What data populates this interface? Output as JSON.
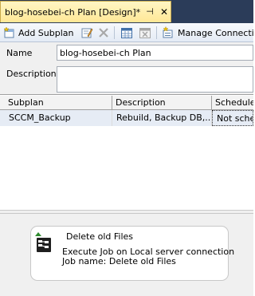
{
  "tab": {
    "title": "blog-hosebei-ch Plan [Design]*",
    "pin_glyph": "⊣",
    "close_glyph": "✕"
  },
  "toolbar": {
    "add_subplan_label": "Add Subplan",
    "manage_connections_label": "Manage Connecti"
  },
  "form": {
    "name_label": "Name",
    "name_value": "blog-hosebei-ch Plan",
    "description_label": "Description",
    "description_value": ""
  },
  "grid": {
    "headers": {
      "subplan": "Subplan",
      "description": "Description",
      "schedule": "Schedule"
    },
    "rows": [
      {
        "subplan": "SCCM_Backup",
        "description": "Rebuild, Backup DB,...",
        "schedule": "Not sched"
      }
    ]
  },
  "task": {
    "title": "Delete old Files",
    "line1": "Execute Job on Local server connection",
    "line2": "Job name: Delete old Files"
  },
  "colors": {
    "tab_bg": "#ffe796",
    "title_strip": "#2b3c59",
    "row_highlight": "#e6ecf5"
  }
}
